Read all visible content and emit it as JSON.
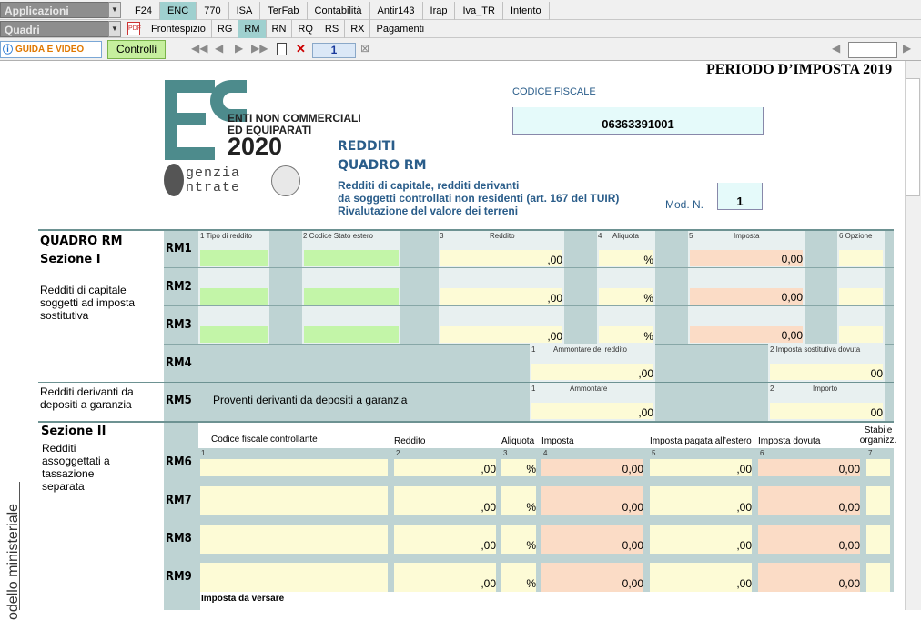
{
  "toolbar": {
    "app_dropdown": "Applicazioni",
    "quadri_dropdown": "Quadri",
    "tabs_row1": [
      "F24",
      "ENC",
      "770",
      "ISA",
      "TerFab",
      "Contabilità",
      "Antir143",
      "Irap",
      "Iva_TR",
      "Intento"
    ],
    "tabs_row2": [
      "Frontespizio",
      "RG",
      "RM",
      "RN",
      "RQ",
      "RS",
      "RX",
      "Pagamenti"
    ],
    "guida_label": "GUIDA E VIDEO",
    "controlli_label": "Controlli",
    "page_number": "1"
  },
  "header": {
    "periodo": "PERIODO D’IMPOSTA 2019",
    "codice_fiscale_label": "CODICE FISCALE",
    "codice_fiscale_value": "06363391001",
    "logo_line1": "ENTI NON COMMERCIALI",
    "logo_line2": "ED EQUIPARATI",
    "logo_year": "2020",
    "agency1": "genzia",
    "agency2": "ntrate",
    "title1": "REDDITI",
    "title2": "QUADRO RM",
    "desc1": "Redditi di capitale, redditi derivanti",
    "desc2": "da soggetti controllati non residenti (art. 167 del TUIR)",
    "desc3": "Rivalutazione del valore dei terreni",
    "mod_label": "Mod. N.",
    "mod_value": "1"
  },
  "section1": {
    "title": "QUADRO RM",
    "subtitle": "Sezione I",
    "desc": "Redditi di capitale soggetti ad imposta sostitutiva",
    "desc2": "Redditi derivanti da depositi a garanzia",
    "col1": "1   Tipo di reddito",
    "col2": "2      Codice Stato estero",
    "col3": "3",
    "col3b": "Reddito",
    "col4": "4",
    "col4b": "Aliquota",
    "col5": "5",
    "col5b": "Imposta",
    "col6": "6 Opzione",
    "rows": [
      {
        "code": "RM1",
        "reddito": ",00",
        "aliquota": "%",
        "imposta": "0,00"
      },
      {
        "code": "RM2",
        "reddito": ",00",
        "aliquota": "%",
        "imposta": "0,00"
      },
      {
        "code": "RM3",
        "reddito": ",00",
        "aliquota": "%",
        "imposta": "0,00"
      }
    ],
    "rm4_code": "RM4",
    "rm4_l1": "1",
    "rm4_l1b": "Ammontare del reddito",
    "rm4_v1": ",00",
    "rm4_l2": "2   Imposta sostitutiva dovuta",
    "rm4_v2": "00",
    "rm5_code": "RM5",
    "rm5_text": "Proventi derivanti da depositi a garanzia",
    "rm5_l1": "1",
    "rm5_l1b": "Ammontare",
    "rm5_v1": ",00",
    "rm5_l2": "2",
    "rm5_l2b": "Importo",
    "rm5_v2": "00"
  },
  "section2": {
    "title": "Sezione II",
    "desc": "Redditi assoggettati a tassazione separata",
    "h1": "Codice fiscale controllante",
    "h2": "Reddito",
    "h3": "Aliquota",
    "h4": "Imposta",
    "h5": "Imposta pagata all’estero",
    "h6": "Imposta dovuta",
    "h7": "Stabile organizz.",
    "n1": "1",
    "n2": "2",
    "n3": "3",
    "n4": "4",
    "n5": "5",
    "n6": "6",
    "n7": "7",
    "rows": [
      {
        "code": "RM6",
        "reddito": ",00",
        "aliquota": "%",
        "imposta": "0,00",
        "estero": ",00",
        "dovuta": "0,00"
      },
      {
        "code": "RM7",
        "reddito": ",00",
        "aliquota": "%",
        "imposta": "0,00",
        "estero": ",00",
        "dovuta": "0,00"
      },
      {
        "code": "RM8",
        "reddito": ",00",
        "aliquota": "%",
        "imposta": "0,00",
        "estero": ",00",
        "dovuta": "0,00"
      },
      {
        "code": "RM9",
        "reddito": ",00",
        "aliquota": "%",
        "imposta": "0,00",
        "estero": ",00",
        "dovuta": "0,00"
      }
    ],
    "imposta_versare": "Imposta da versare"
  },
  "side_label": "odello ministeriale"
}
